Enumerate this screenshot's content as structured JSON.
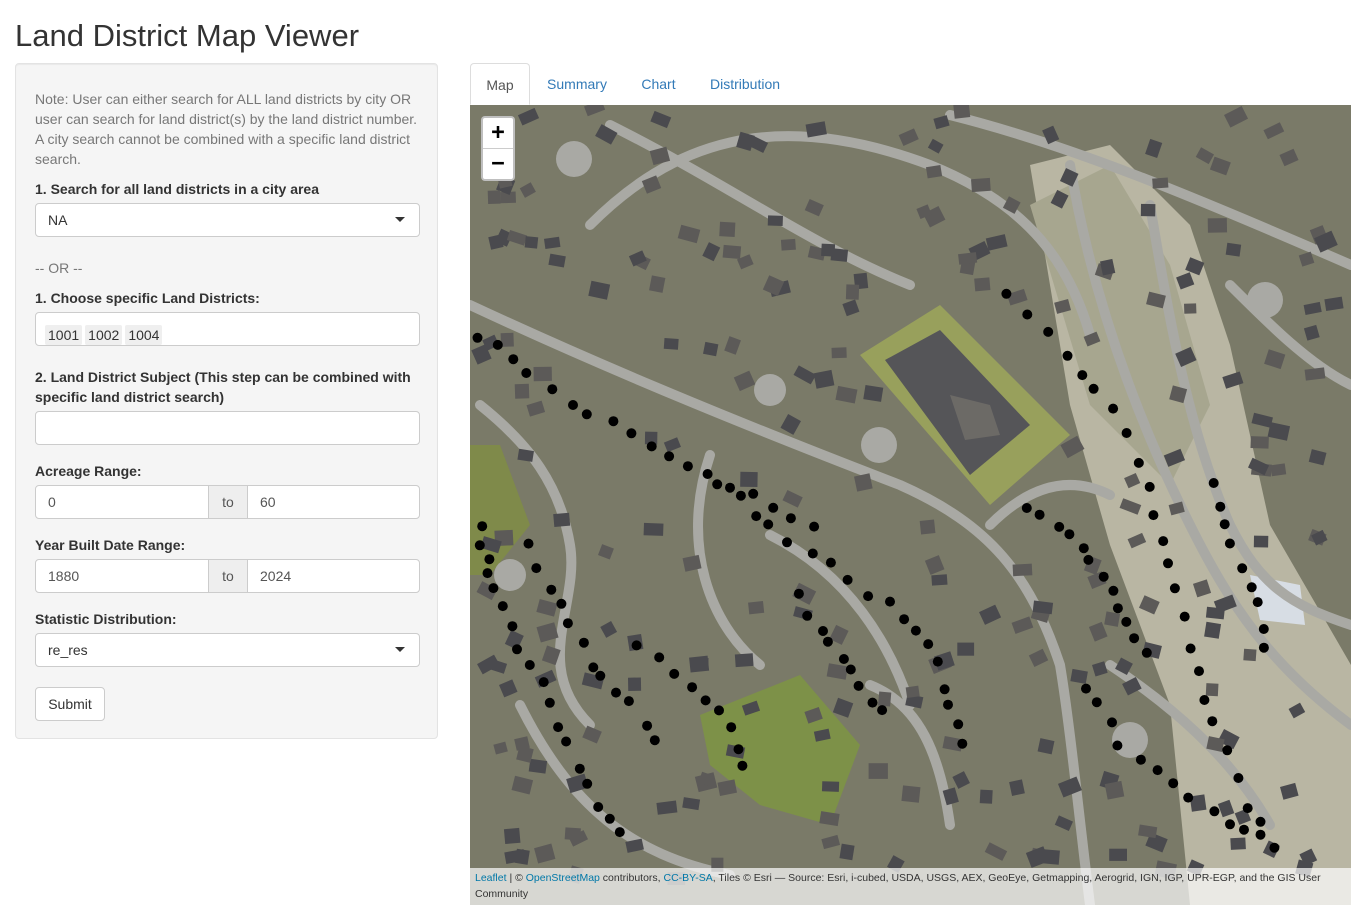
{
  "page": {
    "title": "Land District Map Viewer"
  },
  "sidebar": {
    "note": "Note: User can either search for ALL land districts by city OR user can search for land district(s) by the land district number. A city search cannot be combined with a specific land district search.",
    "city_label": "1. Search for all land districts in a city area",
    "city_value": "NA",
    "or_text": "-- OR --",
    "districts_label": "1. Choose specific Land Districts:",
    "districts_selected": [
      "1001",
      "1002",
      "1004"
    ],
    "subject_label": "2. Land District Subject (This step can be combined with specific land district search)",
    "subject_value": "",
    "acreage_label": "Acreage Range:",
    "acreage_min": "0",
    "acreage_max": "60",
    "year_label": "Year Built Date Range:",
    "year_min": "1880",
    "year_max": "2024",
    "range_sep": "to",
    "stat_label": "Statistic Distribution:",
    "stat_value": "re_res",
    "submit_label": "Submit"
  },
  "tabs": [
    {
      "label": "Map",
      "active": true
    },
    {
      "label": "Summary",
      "active": false
    },
    {
      "label": "Chart",
      "active": false
    },
    {
      "label": "Distribution",
      "active": false
    }
  ],
  "map": {
    "zoom_in": "+",
    "zoom_out": "−",
    "attribution": {
      "leaflet": "Leaflet",
      "sep1": " | © ",
      "osm": "OpenStreetMap",
      "contrib": " contributors, ",
      "license": "CC-BY-SA",
      "tiles": ", Tiles © Esri — Source: Esri, i-cubed, USDA, USGS, AEX, GeoEye, Getmapping, Aerogrid, IGN, IGP, UPR-EGP, and the GIS User Community"
    },
    "colors": {
      "marker": "#000000",
      "road": "#9a9a96",
      "roof": "#4a4a4e",
      "grass": "#7d8a4c"
    }
  }
}
